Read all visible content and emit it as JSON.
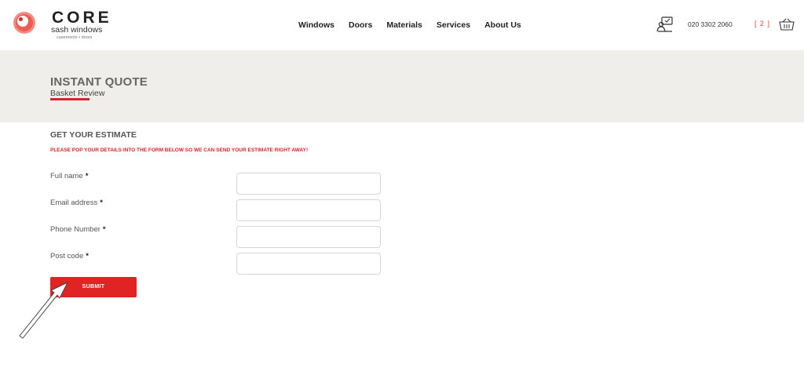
{
  "brand": {
    "name": "CORE",
    "subtitle": "sash windows",
    "tagline": "casements • doors",
    "accent": "#e02323"
  },
  "nav": {
    "items": [
      {
        "label": "Windows"
      },
      {
        "label": "Doors"
      },
      {
        "label": "Materials"
      },
      {
        "label": "Services"
      },
      {
        "label": "About Us"
      }
    ]
  },
  "header": {
    "contact_icon": "contact-monitor-icon",
    "phone": "020 3302 2060",
    "basket_count": "[ 2 ]",
    "basket_icon": "basket-icon"
  },
  "banner": {
    "title": "INSTANT QUOTE",
    "subtitle": "Basket Review",
    "background": "#f0eeeb"
  },
  "form": {
    "title": "GET YOUR ESTIMATE",
    "note": "PLEASE POP YOUR DETAILS INTO THE FORM BELOW SO WE CAN SEND YOUR ESTIMATE RIGHT AWAY!",
    "fields": [
      {
        "label": "Full name",
        "required_mark": "*",
        "value": ""
      },
      {
        "label": "Email address",
        "required_mark": "*",
        "value": ""
      },
      {
        "label": "Phone Number",
        "required_mark": "*",
        "value": ""
      },
      {
        "label": "Post code",
        "required_mark": "*",
        "value": ""
      }
    ],
    "submit_label": "SUBMIT"
  },
  "annotation": {
    "pointer": "arrow-pointer-icon"
  }
}
